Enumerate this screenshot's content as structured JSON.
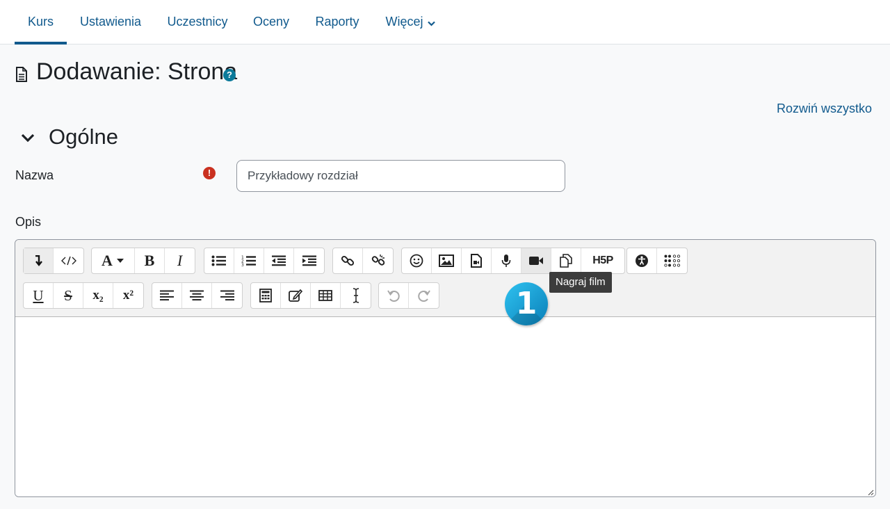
{
  "nav": {
    "tabs": [
      {
        "label": "Kurs",
        "active": true
      },
      {
        "label": "Ustawienia",
        "active": false
      },
      {
        "label": "Uczestnicy",
        "active": false
      },
      {
        "label": "Oceny",
        "active": false
      },
      {
        "label": "Raporty",
        "active": false
      },
      {
        "label": "Więcej",
        "active": false,
        "dropdown": true
      }
    ]
  },
  "page": {
    "title": "Dodawanie: Strona",
    "help_icon": "?",
    "expand_all": "Rozwiń wszystko"
  },
  "section": {
    "title": "Ogólne"
  },
  "form": {
    "name_label": "Nazwa",
    "required_icon": "!",
    "name_value": "Przykładowy rozdział",
    "description_label": "Opis"
  },
  "editor": {
    "row1": [
      [
        "collapse-toolbar-icon",
        "html-source-icon"
      ],
      [
        "font-style-icon",
        "bold-icon",
        "italic-icon"
      ],
      [
        "bullet-list-icon",
        "numbered-list-icon",
        "outdent-icon",
        "indent-icon"
      ],
      [
        "link-icon",
        "unlink-icon"
      ],
      [
        "emoticon-icon",
        "image-icon",
        "media-icon",
        "record-audio-icon",
        "record-video-icon",
        "manage-files-icon",
        "h5p-icon"
      ],
      [
        "accessibility-checker-icon",
        "screen-reader-helper-icon"
      ]
    ],
    "row2": [
      [
        "underline-icon",
        "strikethrough-icon",
        "subscript-icon",
        "superscript-icon"
      ],
      [
        "align-left-icon",
        "align-center-icon",
        "align-right-icon"
      ],
      [
        "equation-icon",
        "special-char-icon",
        "table-icon",
        "clear-formatting-icon"
      ],
      [
        "undo-icon",
        "redo-icon"
      ]
    ],
    "labels": {
      "bold": "B",
      "italic": "I",
      "underline": "U",
      "strike": "S",
      "subscript": "x₂",
      "superscript": "x²",
      "h5p": "H5P",
      "font": "A"
    },
    "tooltip": "Nagraj film"
  },
  "callout": {
    "number": "1",
    "color_start": "#2fc2f0",
    "color_end": "#0a7fb8"
  },
  "colors": {
    "link": "#115a8d",
    "required": "#ca3120",
    "help": "#0b7a9a"
  }
}
